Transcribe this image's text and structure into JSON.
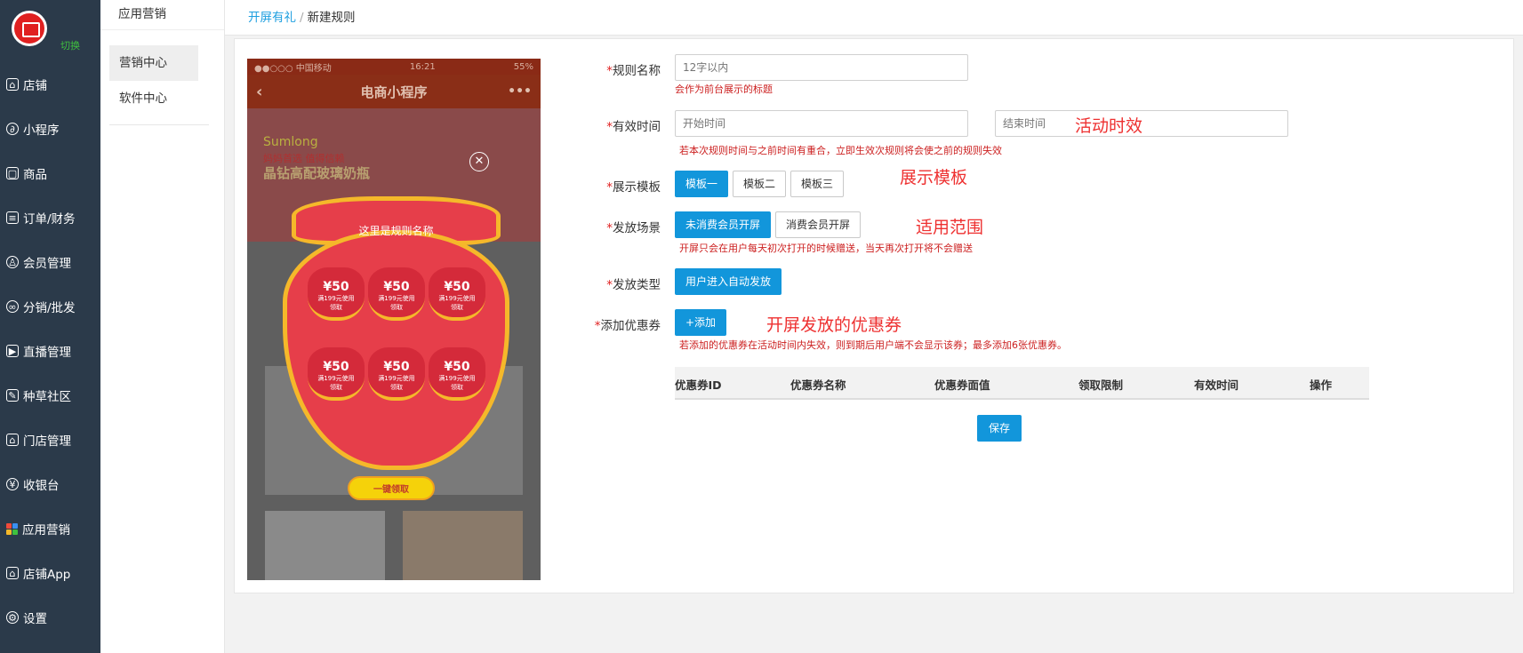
{
  "sidebar": {
    "switch_label": "切换",
    "items": [
      {
        "label": "店铺",
        "icon": "store-icon"
      },
      {
        "label": "小程序",
        "icon": "miniprogram-icon"
      },
      {
        "label": "商品",
        "icon": "bag-icon"
      },
      {
        "label": "订单/财务",
        "icon": "order-icon"
      },
      {
        "label": "会员管理",
        "icon": "member-icon"
      },
      {
        "label": "分销/批发",
        "icon": "distribution-icon"
      },
      {
        "label": "直播管理",
        "icon": "live-icon"
      },
      {
        "label": "种草社区",
        "icon": "community-icon"
      },
      {
        "label": "门店管理",
        "icon": "home-icon"
      },
      {
        "label": "收银台",
        "icon": "cashier-icon"
      },
      {
        "label": "应用营销",
        "icon": "apps-icon"
      },
      {
        "label": "店铺App",
        "icon": "app-icon"
      },
      {
        "label": "设置",
        "icon": "gear-icon"
      }
    ]
  },
  "subnav": {
    "title": "应用营销",
    "items": [
      "营销中心",
      "软件中心"
    ]
  },
  "breadcrumb": {
    "parent": "开屏有礼",
    "separator": "/",
    "current": "新建规则"
  },
  "preview": {
    "status_carrier": "●●○○○ 中国移动 ",
    "status_time": "16:21",
    "status_battery": "55%",
    "nav_title": "电商小程序",
    "banner_brand": "Sumlong",
    "banner_sub": "妈妈首选  值得信赖",
    "banner_headline": "晶钻高配玻璃奶瓶",
    "bag_title": "这里是规则名称",
    "coupon_value": "50",
    "coupon_currency": "¥",
    "coupon_cond": "满199元使用",
    "coupon_btn": "领取",
    "grab_button": "一键领取"
  },
  "form": {
    "required_mark": "*",
    "name": {
      "label": "规则名称",
      "placeholder": "12字以内",
      "hint": "会作为前台展示的标题"
    },
    "time": {
      "label": "有效时间",
      "start_placeholder": "开始时间",
      "end_placeholder": "结束时间",
      "hint": "若本次规则时间与之前时间有重合，立即生效次规则将会使之前的规则失效",
      "annotation": "活动时效"
    },
    "template": {
      "label": "展示模板",
      "options": [
        "模板一",
        "模板二",
        "模板三"
      ],
      "annotation": "展示模板"
    },
    "scene": {
      "label": "发放场景",
      "options": [
        "未消费会员开屏",
        "消费会员开屏"
      ],
      "hint": "开屏只会在用户每天初次打开的时候赠送，当天再次打开将不会赠送",
      "annotation": "适用范围"
    },
    "type": {
      "label": "发放类型",
      "option": "用户进入自动发放"
    },
    "coupon": {
      "label": "添加优惠券",
      "add_button": "+添加",
      "hint": "若添加的优惠券在活动时间内失效，则到期后用户端不会显示该券；最多添加6张优惠券。",
      "annotation": "开屏发放的优惠券"
    },
    "table_headers": [
      "优惠券ID",
      "优惠券名称",
      "优惠券面值",
      "领取限制",
      "有效时间",
      "操作"
    ],
    "save_button": "保存"
  },
  "colors": {
    "sidebar_bg": "#2b3a4a",
    "primary": "#1296db",
    "link": "#1e9fe0",
    "required": "#e02020",
    "hint": "#cc2020",
    "annotation": "#ee3030",
    "switch": "#3fc03f"
  }
}
